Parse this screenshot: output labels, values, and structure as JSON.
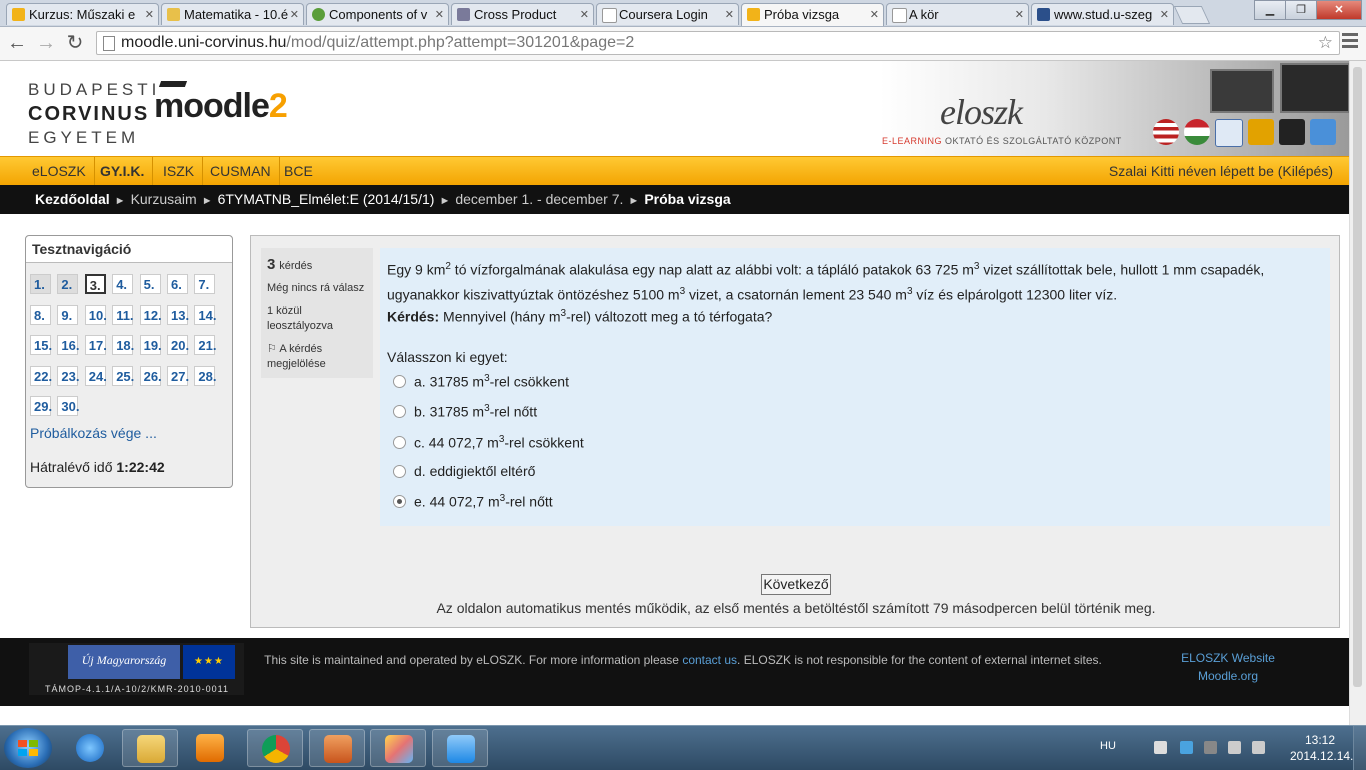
{
  "browser": {
    "tabs": [
      {
        "title": "Kurzus: Műszaki e",
        "color": "#f2b319"
      },
      {
        "title": "Matematika - 10.é",
        "color": "#e8c04a"
      },
      {
        "title": "Components of v",
        "color": "#5a9e3a"
      },
      {
        "title": "Cross Product",
        "color": "#7a7a9a"
      },
      {
        "title": "Coursera Login",
        "color": "#ffffff"
      },
      {
        "title": "Próba vizsga",
        "color": "#f2b319"
      },
      {
        "title": "A kör",
        "color": "#ffffff"
      },
      {
        "title": "www.stud.u-szeg",
        "color": "#2b4f8a"
      }
    ],
    "url_host": "moodle.uni-corvinus.hu",
    "url_path": "/mod/quiz/attempt.php?attempt=301201&page=2"
  },
  "header": {
    "uni_line1": "BUDAPESTI",
    "uni_line2": "CORVINUS",
    "uni_line3": "EGYETEM",
    "moodle_word": "moodle",
    "moodle_version": "2",
    "eloszk_logo": "eloszk",
    "eloszk_sub_red": "E-LEARNING",
    "eloszk_sub_rest": " OKTATÓ ÉS SZOLGÁLTATÓ KÖZPONT"
  },
  "mainnav": {
    "items": [
      "eLOSZK",
      "GY.I.K.",
      "ISZK",
      "CUSMAN",
      "BCE"
    ],
    "login_text": "Szalai Kitti néven lépett be (Kilépés)"
  },
  "breadcrumb": {
    "home": "Kezdőoldal",
    "my_courses": "Kurzusaim",
    "course": "6TYMATNB_Elmélet:E (2014/15/1)",
    "week": "december 1. - december 7.",
    "current": "Próba vizsga",
    "separator": "►"
  },
  "quiz_nav": {
    "title": "Tesztnavigáció",
    "buttons": [
      "1.",
      "2.",
      "3.",
      "4.",
      "5.",
      "6.",
      "7.",
      "8.",
      "9.",
      "10.",
      "11.",
      "12.",
      "13.",
      "14.",
      "15.",
      "16.",
      "17.",
      "18.",
      "19.",
      "20.",
      "21.",
      "22.",
      "23.",
      "24.",
      "25.",
      "26.",
      "27.",
      "28.",
      "29.",
      "30."
    ],
    "finish_link": "Próbálkozás vége ...",
    "time_label": "Hátralévő idő",
    "time_value": "1:22:42"
  },
  "question": {
    "number": "3",
    "number_label": "kérdés",
    "status": "Még nincs rá válasz",
    "grade": "1 közül leosztályozva",
    "flag": "A kérdés megjelölése",
    "text_p1": "Egy 9 km",
    "text_p2": " tó vízforgalmának alakulása egy nap alatt az alábbi volt: a tápláló patakok 63 725 m",
    "text_p3": " vizet szállítottak bele, hullott 1 mm csapadék, ugyanakkor kiszivattyúztak öntözéshez 5100 m",
    "text_p4": " vizet, a csatornán lement 23 540 m",
    "text_p5": " víz és elpárolgott 12300 liter víz.",
    "sup2": "2",
    "sup3": "3",
    "ask_label": "Kérdés:",
    "ask_p1": " Mennyivel (hány  m",
    "ask_p2": "-rel) változott meg a tó térfogata?",
    "prompt": "Válasszon ki egyet:",
    "options": [
      {
        "pre": "a. 31785 m",
        "post": "-rel csökkent"
      },
      {
        "pre": "b. 31785 m",
        "post": "-rel nőtt"
      },
      {
        "pre": "c. 44 072,7 m",
        "post": "-rel csökkent"
      },
      {
        "pre": "d. eddigiektől eltérő",
        "post": ""
      },
      {
        "pre": "e. 44 072,7 m",
        "post": "-rel nőtt"
      }
    ],
    "selected_option": "e",
    "next_button": "Következő",
    "autosave": "Az oldalon automatikus mentés működik, az első mentés a betöltéstől számított 79 másodpercen belül történik meg."
  },
  "footer": {
    "logo_text": "Új Magyarország",
    "eu_stars": "★★★",
    "logo_code": "TÁMOP-4.1.1/A-10/2/KMR-2010-0011",
    "text_1": "This site is maintained and operated by eLOSZK. For more information please ",
    "contact_link": "contact us",
    "text_2": ". ELOSZK is not responsible for the content of external internet sites.",
    "link_eloszk": "ELOSZK Website",
    "link_moodle": "Moodle.org"
  },
  "taskbar": {
    "lang": "HU",
    "time": "13:12",
    "date": "2014.12.14."
  }
}
